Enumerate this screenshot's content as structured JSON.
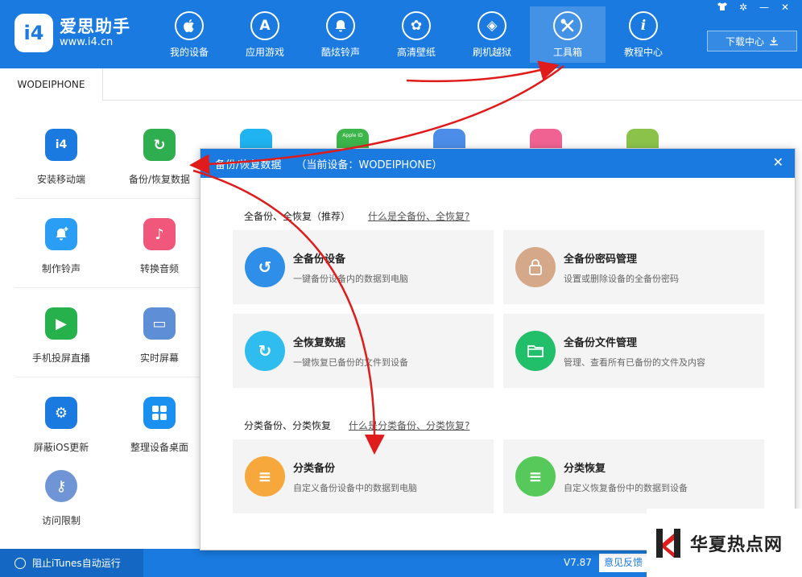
{
  "app": {
    "logo_badge": "i4",
    "title": "爱思助手",
    "url": "www.i4.cn"
  },
  "nav": [
    {
      "label": "我的设备",
      "icon": "apple-icon",
      "glyph": ""
    },
    {
      "label": "应用游戏",
      "icon": "app-store-icon",
      "glyph": "A"
    },
    {
      "label": "酷炫铃声",
      "icon": "bell-icon",
      "glyph": "♪"
    },
    {
      "label": "高清壁纸",
      "icon": "flower-icon",
      "glyph": "✿"
    },
    {
      "label": "刷机越狱",
      "icon": "dropbox-icon",
      "glyph": "◈"
    },
    {
      "label": "工具箱",
      "icon": "tools-icon",
      "glyph": "✕"
    },
    {
      "label": "教程中心",
      "icon": "info-icon",
      "glyph": "i"
    }
  ],
  "nav_active_index": 5,
  "window_controls": [
    "shirt-icon",
    "gear-icon",
    "minimize-icon",
    "close-icon"
  ],
  "download": {
    "label": "下载中心"
  },
  "device_tab": "WODEIPHONE",
  "tools": [
    {
      "label": "安装移动端",
      "icon": "i4-app-icon",
      "color": "#1a7ae0",
      "glyph": "i4"
    },
    {
      "label": "备份/恢复数据",
      "icon": "backup-restore-icon",
      "color": "#2eae4f",
      "glyph": "↻"
    },
    {
      "label": "制作铃声",
      "icon": "bell-plus-icon",
      "color": "#2a9df4",
      "glyph": "♫"
    },
    {
      "label": "转换音频",
      "icon": "music-note-icon",
      "color": "#f0577a",
      "glyph": "♪"
    },
    {
      "label": "手机投屏直播",
      "icon": "play-screen-icon",
      "color": "#27b14c",
      "glyph": "▶"
    },
    {
      "label": "实时屏幕",
      "icon": "monitor-icon",
      "color": "#5e8fd6",
      "glyph": "▭"
    },
    {
      "label": "屏蔽iOS更新",
      "icon": "block-update-icon",
      "color": "#1a7ae0",
      "glyph": "⚙"
    },
    {
      "label": "整理设备桌面",
      "icon": "grid-icon",
      "color": "#1a90f0",
      "glyph": "▦"
    },
    {
      "label": "访问限制",
      "icon": "key-icon",
      "color": "#6f95d6",
      "glyph": "⚷"
    }
  ],
  "peek_icons": [
    {
      "name": "transfer-icon-partial",
      "color": "#1fb3f0"
    },
    {
      "name": "apple-id-icon-partial",
      "color": "#3cb54a",
      "text": "Apple ID"
    },
    {
      "name": "app-store-icon-partial",
      "color": "#4b8de8"
    },
    {
      "name": "itunes-icon-partial",
      "color": "#f06292"
    },
    {
      "name": "box-icon-partial",
      "color": "#8bc34a"
    }
  ],
  "status": {
    "itunes_label": "阻止iTunes自动运行",
    "version": "V7.87",
    "feedback": "意见反馈"
  },
  "dialog": {
    "title": "备份/恢复数据",
    "device": "（当前设备：WODEIPHONE）",
    "full_section": {
      "title": "全备份、全恢复（推荐）",
      "help": "什么是全备份、全恢复?"
    },
    "category_section": {
      "title": "分类备份、分类恢复",
      "help": "什么是分类备份、分类恢复?"
    },
    "cards": [
      {
        "title": "全备份设备",
        "desc": "一键备份设备内的数据到电脑",
        "icon": "full-backup-icon",
        "color": "#2f8fe8",
        "glyph": "↺"
      },
      {
        "title": "全备份密码管理",
        "desc": "设置或删除设备的全备份密码",
        "icon": "lock-icon",
        "color": "#d5a889",
        "glyph": "🔒"
      },
      {
        "title": "全恢复数据",
        "desc": "一键恢复已备份的文件到设备",
        "icon": "full-restore-icon",
        "color": "#2fbdf0",
        "glyph": "↻"
      },
      {
        "title": "全备份文件管理",
        "desc": "管理、查看所有已备份的文件及内容",
        "icon": "folder-icon",
        "color": "#22bf6a",
        "glyph": "▬"
      },
      {
        "title": "分类备份",
        "desc": "自定义备份设备中的数据到电脑",
        "icon": "category-backup-icon",
        "color": "#f6a83d",
        "glyph": "≡"
      },
      {
        "title": "分类恢复",
        "desc": "自定义恢复备份中的数据到设备",
        "icon": "category-restore-icon",
        "color": "#56c95a",
        "glyph": "≡"
      }
    ]
  },
  "watermark": {
    "text": "华夏热点网"
  },
  "annotation_color": "#e01b1b"
}
